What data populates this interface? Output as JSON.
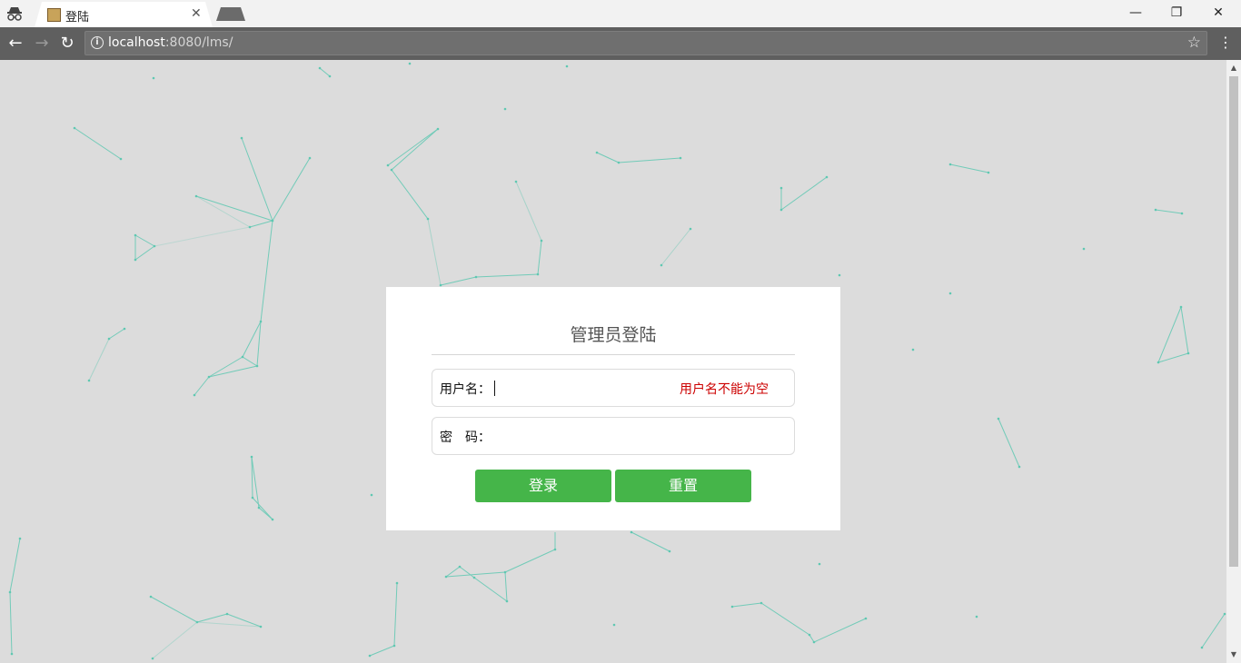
{
  "browser": {
    "tab_title": "登陆",
    "tab_close": "✕",
    "url_host": "localhost",
    "url_rest": ":8080/lms/",
    "window_controls": {
      "minimize": "—",
      "restore": "❐",
      "close": "✕"
    },
    "icons": [
      "incognito-icon",
      "back-icon",
      "forward-icon",
      "reload-icon",
      "info-icon",
      "star-icon",
      "menu-icon"
    ],
    "nav": {
      "back": "←",
      "forward": "→",
      "reload": "↻",
      "star": "☆",
      "menu": "⋮",
      "info": "i"
    }
  },
  "login": {
    "title": "管理员登陆",
    "username_label": "用户名：",
    "username_value": "",
    "username_error": "用户名不能为空",
    "password_label": "密　码：",
    "password_value": "",
    "login_button": "登录",
    "reset_button": "重置"
  },
  "colors": {
    "page_background": "#dcdcdc",
    "card_background": "#ffffff",
    "button_green": "#45b549",
    "error_red": "#cc0000",
    "particle_teal": "#5fc8b2"
  }
}
